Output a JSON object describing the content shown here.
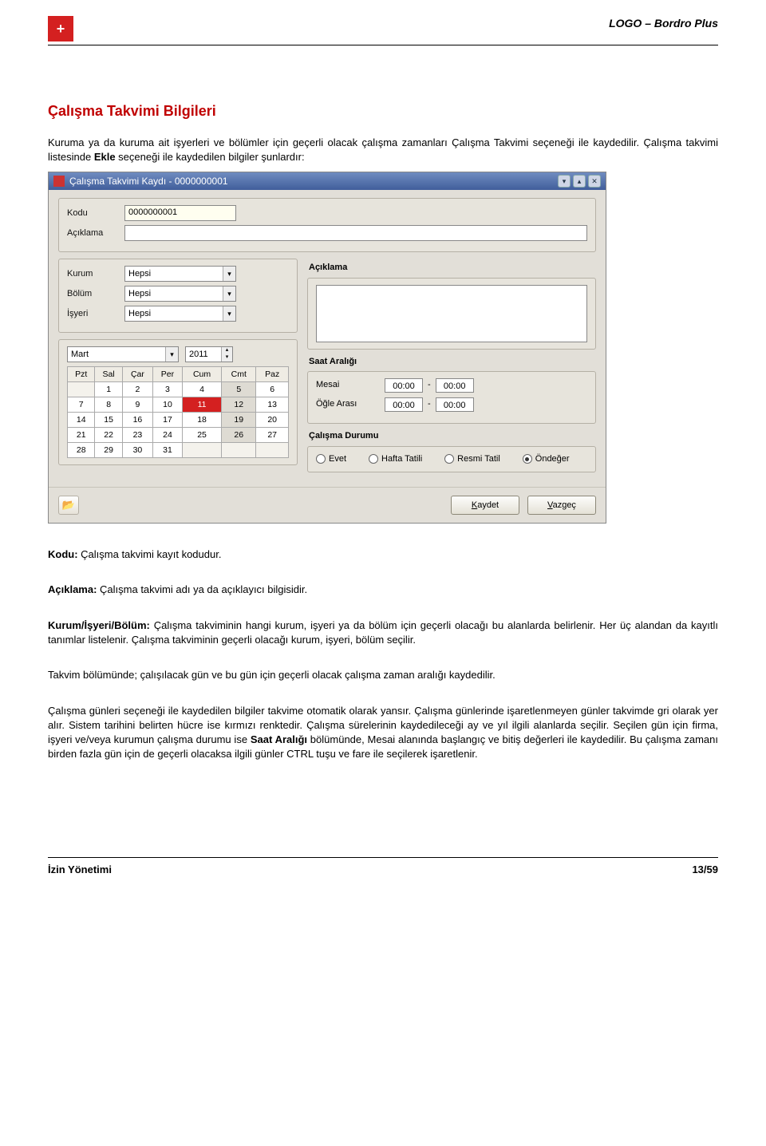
{
  "header": {
    "logo_glyph": "+",
    "brand": "LOGO – Bordro Plus"
  },
  "section_title": "Çalışma Takvimi Bilgileri",
  "intro": "Kuruma ya da kuruma ait işyerleri ve bölümler için geçerli olacak çalışma zamanları Çalışma Takvimi seçeneği ile kaydedilir. Çalışma takvimi listesinde ",
  "intro_bold": "Ekle",
  "intro_tail": " seçeneği ile kaydedilen bilgiler şunlardır:",
  "window": {
    "title": "Çalışma Takvimi Kaydı - 0000000001",
    "title_btn1": "▾",
    "title_btn2": "▴",
    "title_btn3": "✕",
    "kodu_label": "Kodu",
    "kodu_value": "0000000001",
    "aciklama_label": "Açıklama",
    "aciklama_value": "",
    "kurum_label": "Kurum",
    "kurum_value": "Hepsi",
    "bolum_label": "Bölüm",
    "bolum_value": "Hepsi",
    "isyeri_label": "İşyeri",
    "isyeri_value": "Hepsi",
    "right_aciklama_label": "Açıklama",
    "month_value": "Mart",
    "year_value": "2011",
    "days": [
      "Pzt",
      "Sal",
      "Çar",
      "Per",
      "Cum",
      "Cmt",
      "Paz"
    ],
    "weeks": [
      [
        "",
        "1",
        "2",
        "3",
        "4",
        "5",
        "6"
      ],
      [
        "7",
        "8",
        "9",
        "10",
        "11",
        "12",
        "13"
      ],
      [
        "14",
        "15",
        "16",
        "17",
        "18",
        "19",
        "20"
      ],
      [
        "21",
        "22",
        "23",
        "24",
        "25",
        "26",
        "27"
      ],
      [
        "28",
        "29",
        "30",
        "31",
        "",
        "",
        ""
      ]
    ],
    "sel_cell": "11",
    "gray_cells": [
      "5",
      "12",
      "19",
      "26"
    ],
    "saat_label": "Saat Aralığı",
    "mesai_label": "Mesai",
    "ogle_label": "Öğle Arası",
    "zero": "00:00",
    "dash": "-",
    "durum_label": "Çalışma Durumu",
    "radios": {
      "evet": "Evet",
      "hafta": "Hafta Tatili",
      "resmi": "Resmi Tatil",
      "ondeger": "Öndeğer"
    },
    "save_label": "Kaydet",
    "cancel_label": "Vazgeç",
    "open_icon": "📂",
    "dd_glyph": "▾",
    "spin_up": "▴",
    "spin_down": "▾"
  },
  "defs": {
    "kodu_b": "Kodu:",
    "kodu_t": " Çalışma takvimi kayıt kodudur.",
    "acik_b": "Açıklama:",
    "acik_t": " Çalışma takvimi adı ya da açıklayıcı bilgisidir.",
    "kib_b": "Kurum/İşyeri/Bölüm:",
    "kib_t": " Çalışma takviminin hangi kurum, işyeri ya da bölüm için geçerli olacağı bu alanlarda belirlenir. Her üç alandan da kayıtlı tanımlar listelenir. Çalışma takviminin geçerli olacağı kurum, işyeri, bölüm seçilir."
  },
  "para_takvim": "Takvim bölümünde; çalışılacak gün ve bu gün için geçerli olacak çalışma zaman aralığı kaydedilir.",
  "para_last_a": "Çalışma günleri seçeneği ile kaydedilen bilgiler takvime otomatik olarak yansır. Çalışma günlerinde işaretlenmeyen günler takvimde gri olarak yer alır. Sistem tarihini belirten hücre ise kırmızı renktedir. Çalışma sürelerinin kaydedileceği ay ve yıl ilgili alanlarda seçilir. Seçilen gün için firma, işyeri ve/veya kurumun çalışma durumu ise ",
  "para_last_bold": "Saat Aralığı",
  "para_last_b": " bölümünde, Mesai alanında başlangıç ve bitiş değerleri ile kaydedilir. Bu çalışma zamanı birden fazla gün için de geçerli olacaksa  ilgili günler CTRL tuşu ve fare ile seçilerek işaretlenir.",
  "footer": {
    "left": "İzin Yönetimi",
    "right": "13/59"
  }
}
